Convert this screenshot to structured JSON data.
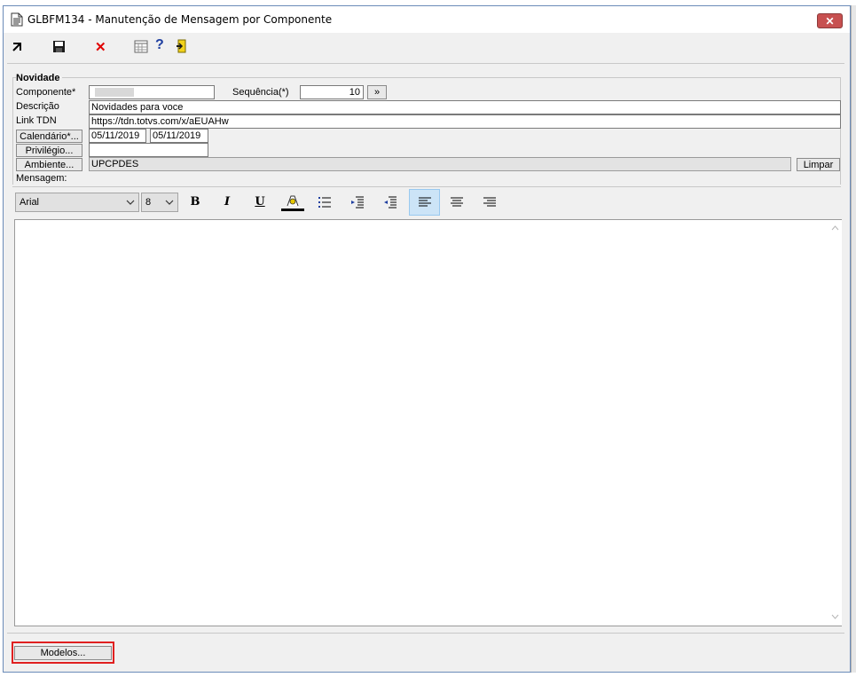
{
  "window": {
    "title": "GLBFM134 - Manutenção de Mensagem por Componente",
    "close_symbol": "✕"
  },
  "toolbar": {
    "icons": [
      "exit-icon",
      "save-icon",
      "cancel-icon",
      "calendar-icon",
      "help-icon",
      "door-icon"
    ],
    "cancel_symbol": "✕",
    "help_symbol": "?"
  },
  "form": {
    "group_title": "Novidade",
    "componente_label": "Componente*",
    "componente_value": "",
    "sequencia_label": "Sequência(*)",
    "sequencia_value": "10",
    "sequencia_button": "»",
    "descricao_label": "Descrição",
    "descricao_value": "Novidades para voce",
    "linktdn_label": "Link TDN",
    "linktdn_value": "https://tdn.totvs.com/x/aEUAHw",
    "calendario_button": "Calendário*...",
    "date_start": "05/11/2019",
    "date_end": "05/11/2019",
    "privilegio_button": "Privilégio...",
    "privilegio_value": "",
    "ambiente_button": "Ambiente...",
    "ambiente_value": "UPCPDES",
    "limpar_button": "Limpar",
    "mensagem_label": "Mensagem:"
  },
  "formatting": {
    "font": "Arial",
    "size": "8",
    "bold": "B",
    "italic": "I",
    "underline": "U"
  },
  "editor": {
    "content": ""
  },
  "footer": {
    "modelos_button": "Modelos..."
  },
  "colors": {
    "window_bg": "#f0f0f0",
    "close_button": "#c75050",
    "highlight": "#e02020",
    "align_active": "#cce4f7"
  }
}
